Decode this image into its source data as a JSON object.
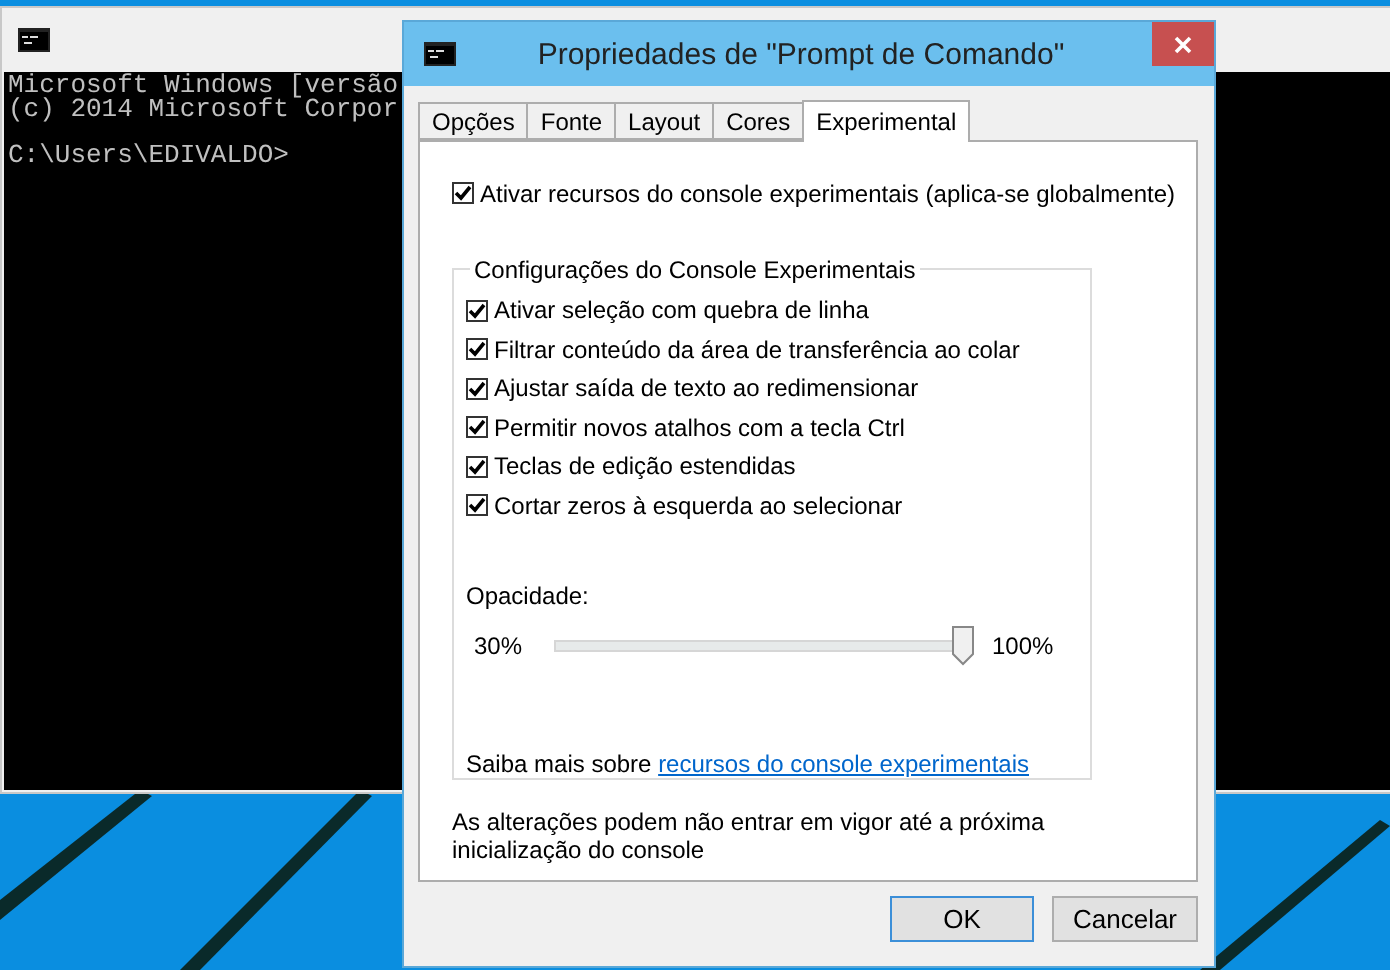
{
  "console": {
    "output_lines": [
      "Microsoft Windows [versão",
      "(c) 2014 Microsoft Corpor"
    ],
    "prompt": "C:\\Users\\EDIVALDO>"
  },
  "dialog": {
    "title": "Propriedades de \"Prompt de Comando\"",
    "tabs": [
      {
        "label": "Opções",
        "selected": false
      },
      {
        "label": "Fonte",
        "selected": false
      },
      {
        "label": "Layout",
        "selected": false
      },
      {
        "label": "Cores",
        "selected": false
      },
      {
        "label": "Experimental",
        "selected": true
      }
    ],
    "enable_checkbox": {
      "label": "Ativar recursos do console experimentais (aplica-se globalmente)",
      "checked": true
    },
    "group": {
      "title": "Configurações do Console Experimentais",
      "options": [
        {
          "label": "Ativar seleção com quebra de linha",
          "checked": true
        },
        {
          "label": "Filtrar conteúdo da área de transferência ao colar",
          "checked": true
        },
        {
          "label": "Ajustar saída de texto ao redimensionar",
          "checked": true
        },
        {
          "label": "Permitir novos atalhos com a tecla Ctrl",
          "checked": true
        },
        {
          "label": "Teclas de edição estendidas",
          "checked": true
        },
        {
          "label": "Cortar zeros à esquerda ao selecionar",
          "checked": true
        }
      ],
      "opacity": {
        "label": "Opacidade:",
        "min_label": "30%",
        "max_label": "100%",
        "level": 1
      },
      "learn_more": {
        "text": "Saiba mais sobre",
        "link": "recursos do console experimentais"
      }
    },
    "note": "As alterações podem não entrar em vigor até a próxima inicialização do console",
    "buttons": [
      {
        "label": "OK",
        "default": true
      },
      {
        "label": "Cancelar",
        "default": false
      }
    ]
  }
}
